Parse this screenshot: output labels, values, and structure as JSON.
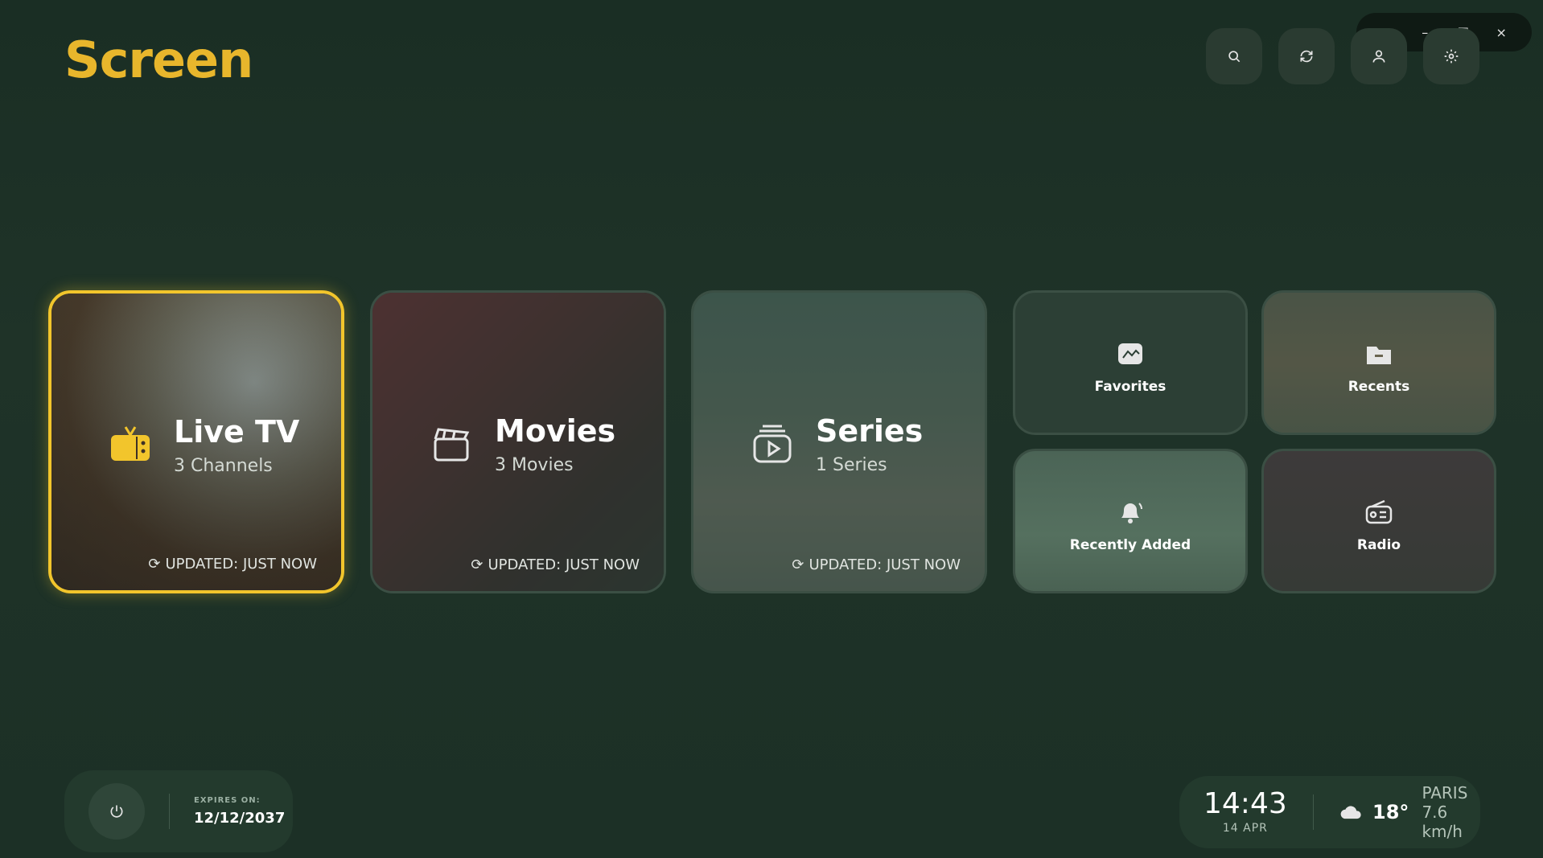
{
  "app": {
    "logo": "Screen"
  },
  "window_controls": {
    "refresh": "⟳",
    "minimize": "–",
    "maximize": "☐",
    "close": "×"
  },
  "top_icons": [
    "search-icon",
    "refresh-icon",
    "user-icon",
    "settings-icon"
  ],
  "cards": {
    "live_tv": {
      "title": "Live TV",
      "subtitle": "3 Channels",
      "updated": "UPDATED: JUST NOW"
    },
    "movies": {
      "title": "Movies",
      "subtitle": "3 Movies",
      "updated": "UPDATED: JUST NOW"
    },
    "series": {
      "title": "Series",
      "subtitle": "1 Series",
      "updated": "UPDATED: JUST NOW"
    },
    "favorites": {
      "label": "Favorites"
    },
    "recents": {
      "label": "Recents"
    },
    "recently_added": {
      "label": "Recently Added"
    },
    "radio": {
      "label": "Radio"
    }
  },
  "expiry": {
    "label": "EXPIRES ON:",
    "date": "12/12/2037"
  },
  "clock": {
    "time": "14:43",
    "date": "14 APR"
  },
  "weather": {
    "temp": "18°",
    "city": "PARIS",
    "wind": "7.6 km/h"
  },
  "colors": {
    "accent": "#f2c52c",
    "logo": "#e8b62c",
    "background": "#1d3127"
  }
}
